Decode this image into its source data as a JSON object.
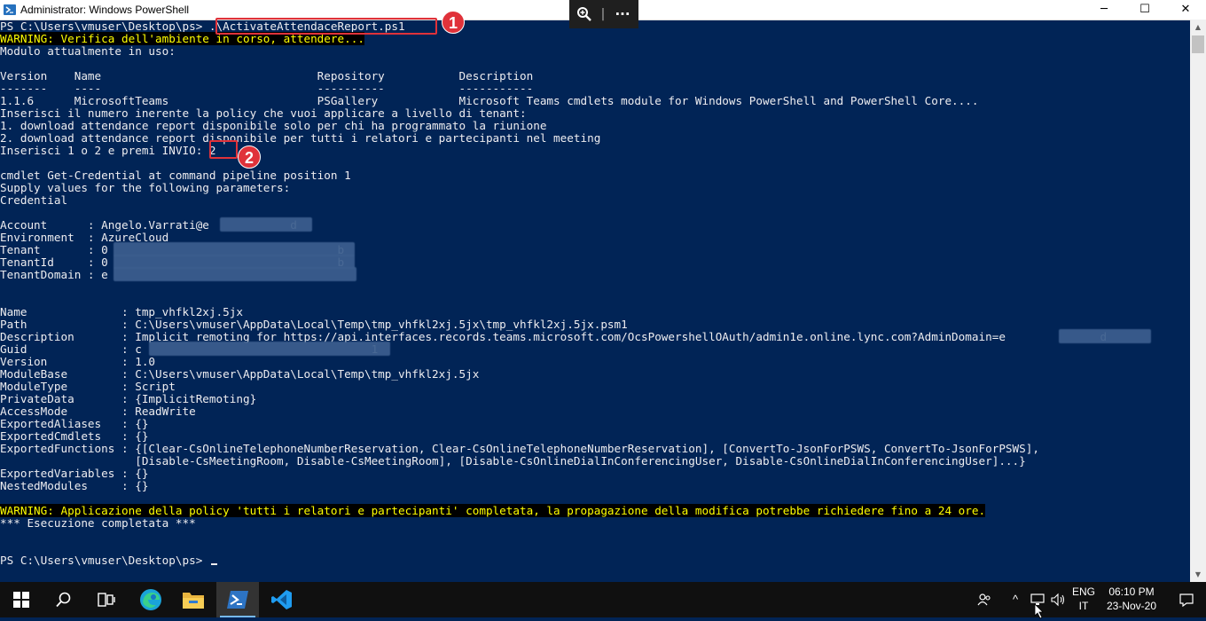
{
  "window": {
    "title": "Administrator: Windows PowerShell",
    "controls": {
      "minimize": "─",
      "maximize": "☐",
      "close": "✕"
    },
    "zoom_toolbar": {
      "zoom_icon": "magnifier-plus-icon",
      "divider": "|",
      "more": "···"
    }
  },
  "console": {
    "lines": [
      {
        "text": "PS C:\\Users\\vmuser\\Desktop\\ps> ",
        "tail": ".\\ActivateAttendaceReport.ps1"
      },
      {
        "text": "WARNING: Verifica dell'ambiente in corso, attendere...",
        "style": "warn"
      },
      {
        "text": "Modulo attualmente in uso:"
      },
      {
        "text": ""
      },
      {
        "text": "Version    Name                                Repository           Description"
      },
      {
        "text": "-------    ----                                ----------           -----------"
      },
      {
        "text": "1.1.6      MicrosoftTeams                      PSGallery            Microsoft Teams cmdlets module for Windows PowerShell and PowerShell Core...."
      },
      {
        "text": "Inserisci il numero inerente la policy che vuoi applicare a livello di tenant:"
      },
      {
        "text": "1. download attendance report disponibile solo per chi ha programmato la riunione"
      },
      {
        "text": "2. download attendance report disponibile per tutti i relatori e partecipanti nel meeting"
      },
      {
        "text": "Inserisci 1 o 2 e premi INVIO: 2"
      },
      {
        "text": ""
      },
      {
        "text": "cmdlet Get-Credential at command pipeline position 1"
      },
      {
        "text": "Supply values for the following parameters:"
      },
      {
        "text": "Credential"
      },
      {
        "text": ""
      },
      {
        "text": "Account      : Angelo.Varrati@e            d"
      },
      {
        "text": "Environment  : AzureCloud"
      },
      {
        "text": "Tenant       : 0                                  b"
      },
      {
        "text": "TenantId     : 0                                  b"
      },
      {
        "text": "TenantDomain : e"
      },
      {
        "text": ""
      },
      {
        "text": ""
      },
      {
        "text": "Name              : tmp_vhfkl2xj.5jx"
      },
      {
        "text": "Path              : C:\\Users\\vmuser\\AppData\\Local\\Temp\\tmp_vhfkl2xj.5jx\\tmp_vhfkl2xj.5jx.psm1"
      },
      {
        "text": "Description       : Implicit remoting for https://api.interfaces.records.teams.microsoft.com/OcsPowershellOAuth/admin1e.online.lync.com?AdminDomain=e              d"
      },
      {
        "text": "Guid              : c                                  1"
      },
      {
        "text": "Version           : 1.0"
      },
      {
        "text": "ModuleBase        : C:\\Users\\vmuser\\AppData\\Local\\Temp\\tmp_vhfkl2xj.5jx"
      },
      {
        "text": "ModuleType        : Script"
      },
      {
        "text": "PrivateData       : {ImplicitRemoting}"
      },
      {
        "text": "AccessMode        : ReadWrite"
      },
      {
        "text": "ExportedAliases   : {}"
      },
      {
        "text": "ExportedCmdlets   : {}"
      },
      {
        "text": "ExportedFunctions : {[Clear-CsOnlineTelephoneNumberReservation, Clear-CsOnlineTelephoneNumberReservation], [ConvertTo-JsonForPSWS, ConvertTo-JsonForPSWS],"
      },
      {
        "text": "                    [Disable-CsMeetingRoom, Disable-CsMeetingRoom], [Disable-CsOnlineDialInConferencingUser, Disable-CsOnlineDialInConferencingUser]...}"
      },
      {
        "text": "ExportedVariables : {}"
      },
      {
        "text": "NestedModules     : {}"
      },
      {
        "text": ""
      },
      {
        "text": "WARNING: Applicazione della policy 'tutti i relatori e partecipanti' completata, la propagazione della modifica potrebbe richiedere fino a 24 ore.",
        "style": "warn"
      },
      {
        "text": "*** Esecuzione completata ***"
      },
      {
        "text": ""
      },
      {
        "text": ""
      },
      {
        "text": "PS C:\\Users\\vmuser\\Desktop\\ps> ",
        "cursor": true
      }
    ],
    "colors": {
      "background": "#012456",
      "foreground": "#eeedf0",
      "warning_fg": "#ffff00",
      "warning_bg": "#000000"
    }
  },
  "annotations": [
    {
      "number": "1",
      "color": "#e0323a"
    },
    {
      "number": "2",
      "color": "#e0323a"
    }
  ],
  "taskbar": {
    "items": [
      "windows-start-icon",
      "search-icon",
      "task-view-icon",
      "edge-browser-icon",
      "file-explorer-icon",
      "powershell-icon",
      "vscode-icon"
    ],
    "tray": {
      "people_icon": "people-icon",
      "chevron": "^",
      "network_icon": "network-icon",
      "volume_icon": "volume-icon",
      "language": "ENG",
      "region": "IT",
      "time": "06:10 PM",
      "date": "23-Nov-20",
      "notification_icon": "notification-icon"
    }
  }
}
